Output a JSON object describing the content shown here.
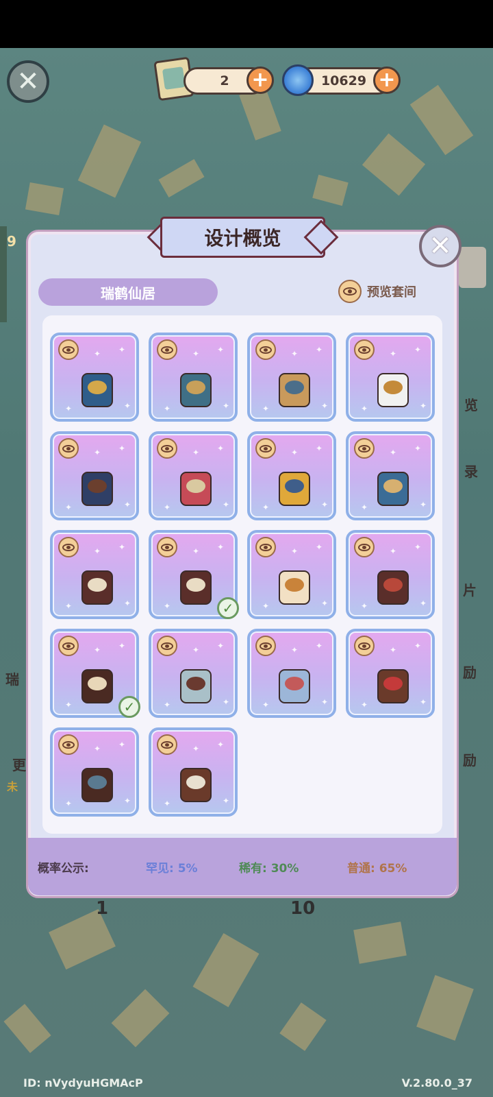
{
  "top_bar": {
    "tickets": "2",
    "currency": "10629"
  },
  "panel": {
    "title": "设计概览",
    "set_name": "瑞鹤仙居",
    "preview_label": "预览套间"
  },
  "items": [
    {
      "name": "incense-burner",
      "owned": false
    },
    {
      "name": "guqin",
      "owned": false
    },
    {
      "name": "pipa",
      "owned": false
    },
    {
      "name": "crane-statue",
      "owned": false
    },
    {
      "name": "lantern-stand",
      "owned": false
    },
    {
      "name": "plum-blossom-vase",
      "owned": false
    },
    {
      "name": "golden-bowl",
      "owned": false
    },
    {
      "name": "wave-rug",
      "owned": false
    },
    {
      "name": "tall-stand",
      "owned": false
    },
    {
      "name": "tall-stand-2",
      "owned": true
    },
    {
      "name": "gourd-vase",
      "owned": false
    },
    {
      "name": "curio-shelf",
      "owned": false
    },
    {
      "name": "armchair",
      "owned": true
    },
    {
      "name": "folding-screen",
      "owned": false
    },
    {
      "name": "hanging-curtain",
      "owned": false
    },
    {
      "name": "canopy-bed",
      "owned": false
    },
    {
      "name": "long-table",
      "owned": false
    },
    {
      "name": "lattice-screen",
      "owned": false
    }
  ],
  "probability": {
    "label": "概率公示:",
    "rare": "罕见: 5%",
    "epic": "稀有: 30%",
    "common": "普通: 65%"
  },
  "background_fragments": {
    "left_1": "瑞",
    "left_2": "更",
    "left_3": "未",
    "right_1": "览",
    "right_2": "录",
    "right_3": "片",
    "right_4": "励",
    "right_5": "励",
    "count_left": "1",
    "count_right": "10",
    "badge": "9"
  },
  "footer": {
    "id": "ID:  nVydyuHGMAcP",
    "version": "V.2.80.0_37"
  },
  "colors": {
    "card_border": "#8fb0e8",
    "title_border": "#6b2d3c",
    "prob_bar": "#b9a3dc"
  }
}
